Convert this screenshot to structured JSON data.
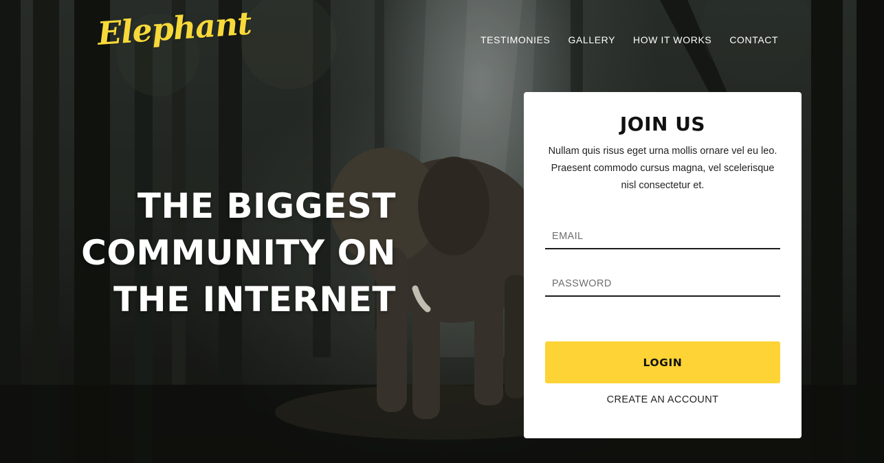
{
  "brand": {
    "logo_text": "Elephant",
    "accent_color": "#fdd335"
  },
  "nav": {
    "items": [
      {
        "label": "TESTIMONIES"
      },
      {
        "label": "GALLERY"
      },
      {
        "label": "HOW IT WORKS"
      },
      {
        "label": "CONTACT"
      }
    ]
  },
  "hero": {
    "headline_lines": [
      "THE BIGGEST",
      "COMMUNITY ON",
      "THE INTERNET"
    ],
    "background_image": "elephant-in-misty-forest"
  },
  "join_card": {
    "title": "JOIN US",
    "description": "Nullam quis risus eget urna mollis ornare vel eu leo. Praesent commodo cursus magna, vel scelerisque nisl consectetur et.",
    "email_placeholder": "EMAIL",
    "email_value": "",
    "password_placeholder": "PASSWORD",
    "password_value": "",
    "login_label": "LOGIN",
    "create_account_label": "CREATE AN ACCOUNT"
  }
}
